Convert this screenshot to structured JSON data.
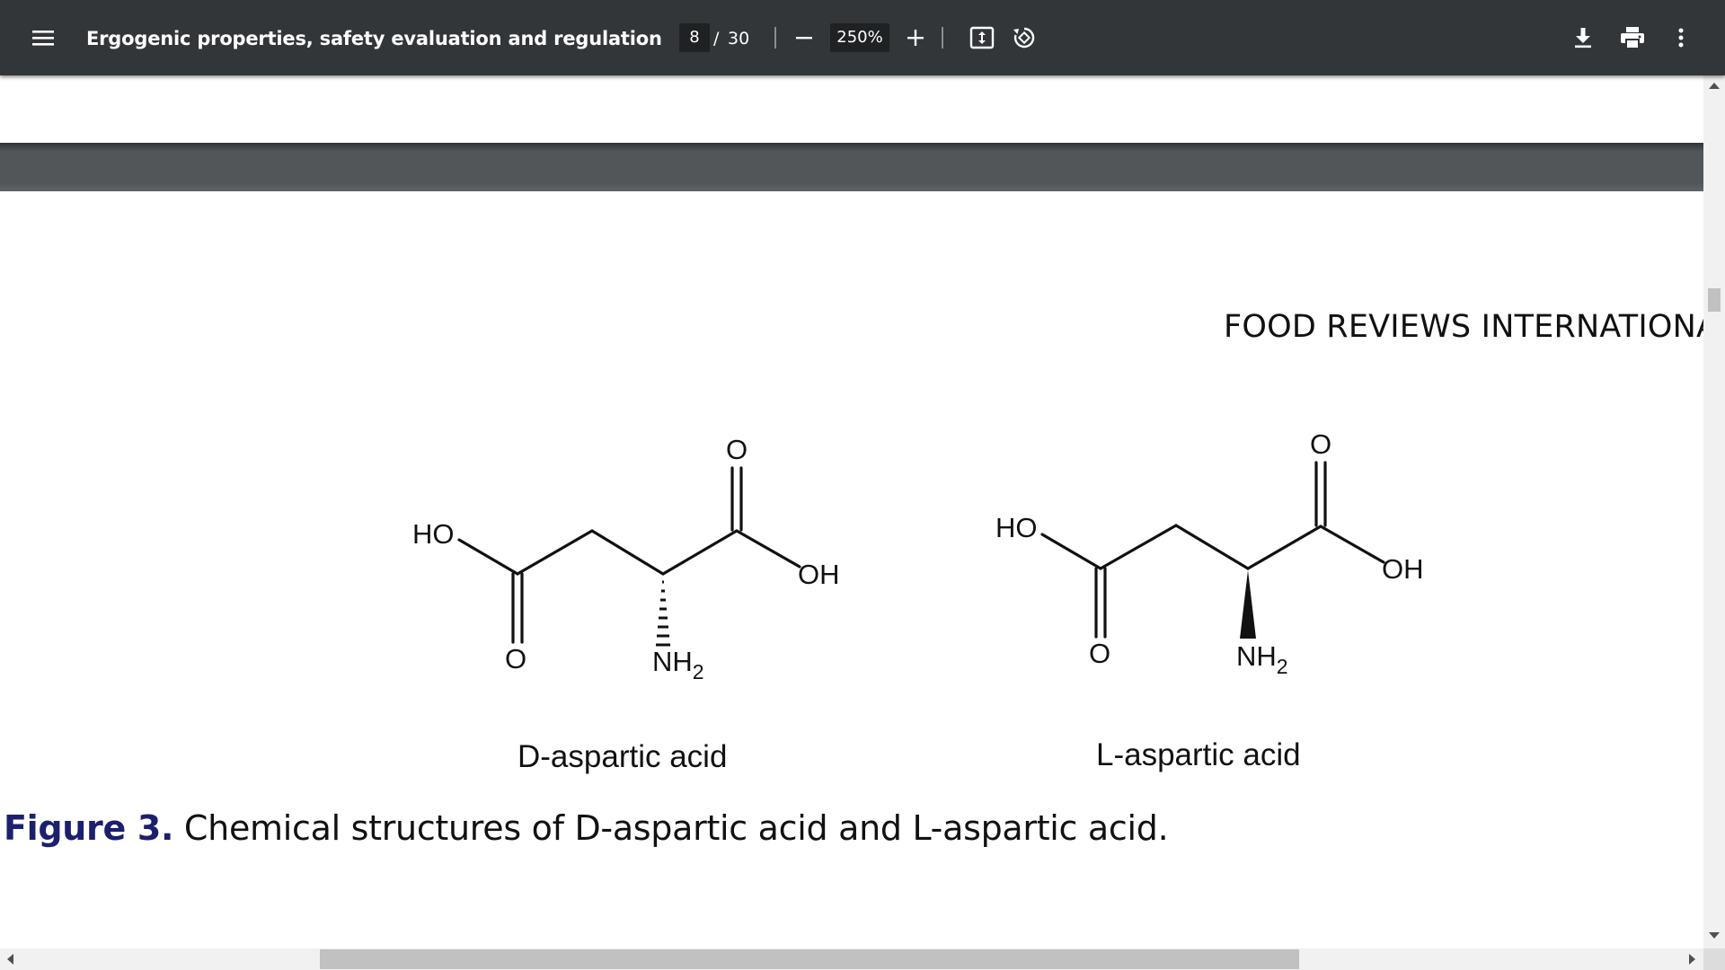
{
  "toolbar": {
    "menu_icon": "hamburger-menu-icon",
    "title": "Ergogenic properties, safety evaluation and regulations of select...",
    "current_page": "8",
    "page_separator": "/",
    "total_pages": "30",
    "zoom_out_icon": "minus-icon",
    "zoom": "250%",
    "zoom_in_icon": "plus-icon",
    "fit_icon": "fit-to-page-icon",
    "rotate_icon": "rotate-icon",
    "download_icon": "download-icon",
    "print_icon": "print-icon",
    "more_icon": "more-vertical-icon"
  },
  "document": {
    "journal_header": "FOOD REVIEWS INTERNATIONAL",
    "molecules": [
      {
        "name": "D-aspartic acid",
        "labels": {
          "ho": "HO",
          "oh": "OH",
          "o_top": "O",
          "o_bottom": "O",
          "nh": "NH",
          "sub": "2"
        },
        "stereo": "hashed-wedge"
      },
      {
        "name": "L-aspartic acid",
        "labels": {
          "ho": "HO",
          "oh": "OH",
          "o_top": "O",
          "o_bottom": "O",
          "nh": "NH",
          "sub": "2"
        },
        "stereo": "solid-wedge"
      }
    ],
    "caption": {
      "label": "Figure 3.",
      "text": " Chemical structures of D-aspartic acid and L-aspartic acid."
    }
  },
  "colors": {
    "toolbar_bg": "#323639",
    "caption_label": "#1c1f6e",
    "page_gap": "#525659"
  }
}
